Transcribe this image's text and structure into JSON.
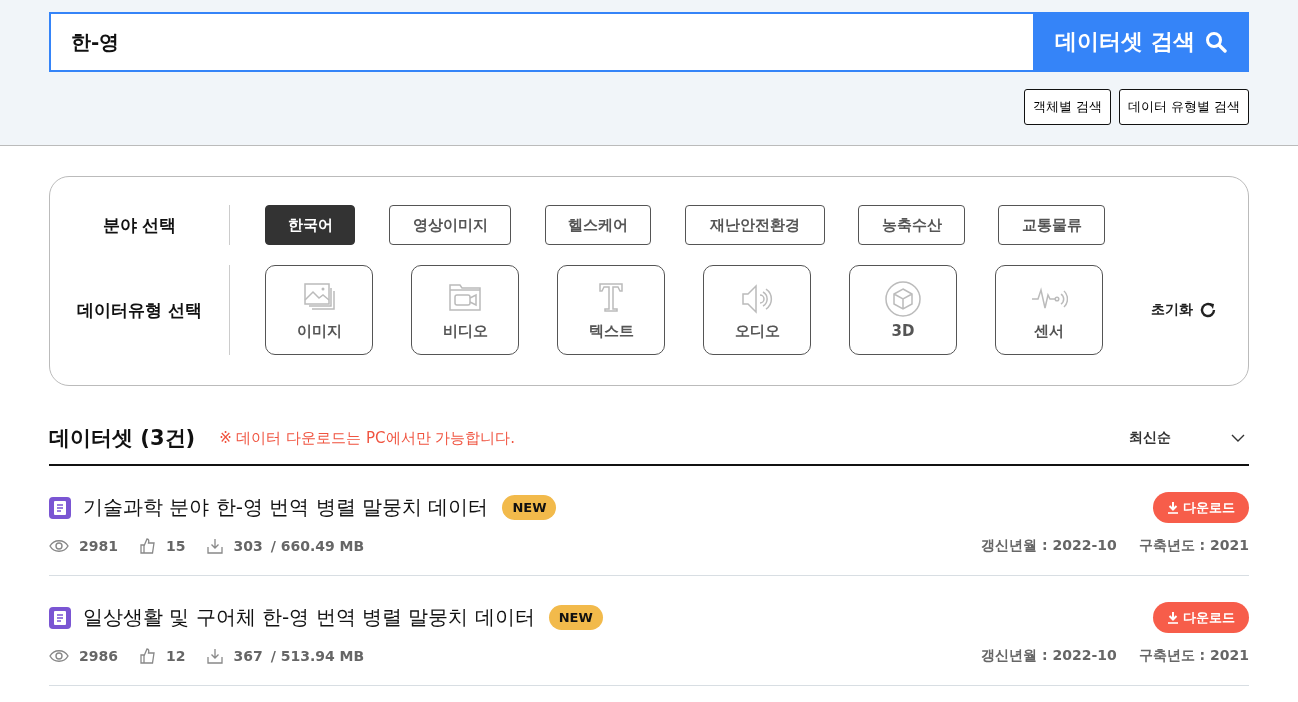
{
  "search": {
    "value": "한-영",
    "button": "데이터셋 검색",
    "sub_buttons": [
      "객체별 검색",
      "데이터 유형별 검색"
    ]
  },
  "filters": {
    "field_label": "분야 선택",
    "fields": [
      {
        "label": "한국어",
        "selected": true
      },
      {
        "label": "영상이미지",
        "selected": false
      },
      {
        "label": "헬스케어",
        "selected": false
      },
      {
        "label": "재난안전환경",
        "selected": false
      },
      {
        "label": "농축수산",
        "selected": false
      },
      {
        "label": "교통물류",
        "selected": false
      }
    ],
    "type_label": "데이터유형 선택",
    "types": [
      {
        "label": "이미지",
        "kind": "image",
        "selected": false
      },
      {
        "label": "비디오",
        "kind": "video",
        "selected": false
      },
      {
        "label": "텍스트",
        "kind": "text",
        "selected": false
      },
      {
        "label": "오디오",
        "kind": "audio",
        "selected": false
      },
      {
        "label": "3D",
        "kind": "cube",
        "selected": false
      },
      {
        "label": "센서",
        "kind": "sensor",
        "selected": false
      }
    ],
    "reset": "초기화"
  },
  "results": {
    "title": "데이터셋 (3건)",
    "notice": "※ 데이터 다운로드는 PC에서만 가능합니다.",
    "sort": "최신순",
    "items": [
      {
        "title": "기술과학 분야 한-영 번역 병렬 말뭉치 데이터",
        "badge": "NEW",
        "download": "다운로드",
        "views": "2981",
        "likes": "15",
        "downloads": "303",
        "size": "/ 660.49 MB",
        "updated": "갱신년월 : 2022-10",
        "built": "구축년도 : 2021"
      },
      {
        "title": "일상생활 및 구어체 한-영 번역 병렬 말뭉치 데이터",
        "badge": "NEW",
        "download": "다운로드",
        "views": "2986",
        "likes": "12",
        "downloads": "367",
        "size": "/ 513.94 MB",
        "updated": "갱신년월 : 2022-10",
        "built": "구축년도 : 2021"
      }
    ]
  }
}
